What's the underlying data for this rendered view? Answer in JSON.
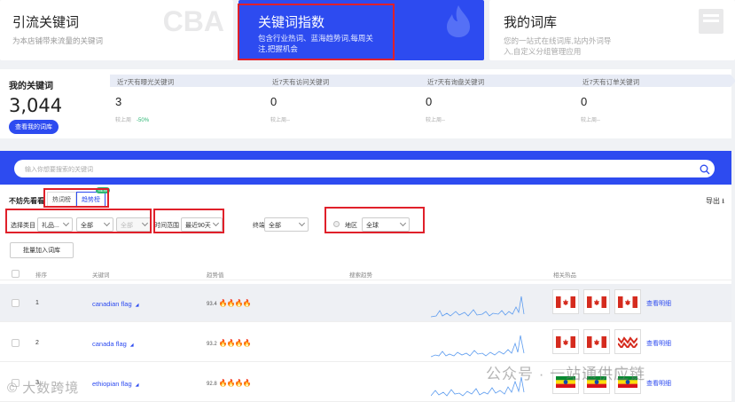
{
  "cards": [
    {
      "title": "引流关键词",
      "desc": "为本店铺带来流量的关键词",
      "deco": "CBA"
    },
    {
      "title": "关键词指数",
      "desc": "包含行业热词、蓝海趋势词,每周关注,把握机会",
      "deco": "🔥"
    },
    {
      "title": "我的词库",
      "desc": "您的一站式在线词库,站内外词导入,自定义分组管理应用",
      "deco": "▤"
    }
  ],
  "my_keywords": {
    "label": "我的关键词",
    "count": "3,044",
    "button": "查看我的词库"
  },
  "stats": [
    {
      "head": "近7天有曝光关键词",
      "value": "3",
      "sub": "较上周",
      "pct": "-50%"
    },
    {
      "head": "近7天有访问关键词",
      "value": "0",
      "sub": "较上周--",
      "pct": ""
    },
    {
      "head": "近7天有询盘关键词",
      "value": "0",
      "sub": "较上周--",
      "pct": ""
    },
    {
      "head": "近7天有订单关键词",
      "value": "0",
      "sub": "较上周--",
      "pct": ""
    }
  ],
  "search": {
    "placeholder": "输入你想要搜索的关键词"
  },
  "recommend": {
    "label": "不妨先看看",
    "tab1": "热词榜",
    "tab2": "趋势榜",
    "badge": "NEW",
    "export": "导出 ⭳"
  },
  "filters": {
    "category_label": "选择类目",
    "category_value": "礼品...",
    "sub1": "全部",
    "sub2": "全部",
    "time_label": "时间范围",
    "time_value": "最近90天",
    "terminal_label": "终端",
    "terminal_value": "全部",
    "region_label": "地区",
    "region_value": "全球"
  },
  "batch_button": "批量加入词库",
  "table": {
    "headers": {
      "rank": "排序",
      "keyword": "关键词",
      "index": "趋势值",
      "trend": "搜索趋势",
      "products": "相关热品"
    },
    "detail": "查看明细",
    "rows": [
      {
        "rank": "1",
        "keyword": "canadian flag",
        "score": "93.4",
        "fires": "🔥🔥🔥🔥"
      },
      {
        "rank": "2",
        "keyword": "canada flag",
        "score": "93.2",
        "fires": "🔥🔥🔥🔥"
      },
      {
        "rank": "3",
        "keyword": "ethiopian flag",
        "score": "92.8",
        "fires": "🔥🔥🔥🔥"
      }
    ]
  },
  "watermarks": {
    "left": "© 大数跨境",
    "right": "公众号 · 一站通供应链"
  }
}
